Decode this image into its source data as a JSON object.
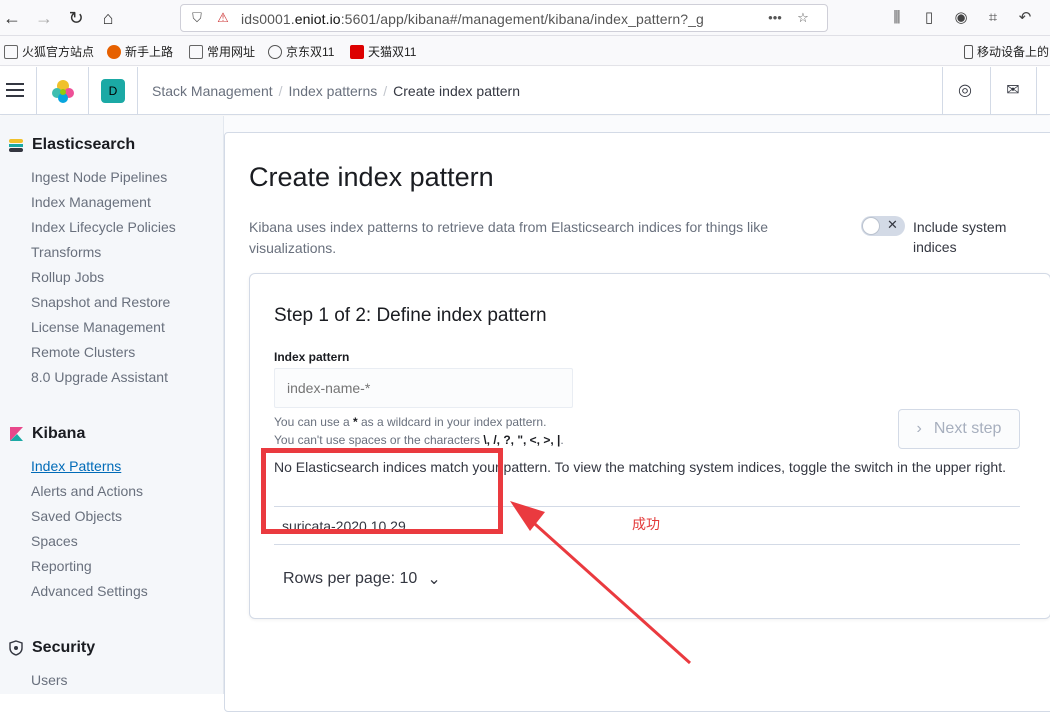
{
  "browser": {
    "url_prefix": "ids0001.",
    "url_host": "eniot.io",
    "url_rest": ":5601/app/kibana#/management/kibana/index_pattern?_g",
    "bookmarks": [
      "火狐官方站点",
      "新手上路",
      "常用网址",
      "京东双11",
      "天猫双11",
      "移动设备上的"
    ]
  },
  "header": {
    "space_initial": "D",
    "breadcrumbs": [
      "Stack Management",
      "Index patterns",
      "Create index pattern"
    ]
  },
  "sidebar": {
    "elasticsearch": {
      "title": "Elasticsearch",
      "items": [
        "Ingest Node Pipelines",
        "Index Management",
        "Index Lifecycle Policies",
        "Transforms",
        "Rollup Jobs",
        "Snapshot and Restore",
        "License Management",
        "Remote Clusters",
        "8.0 Upgrade Assistant"
      ]
    },
    "kibana": {
      "title": "Kibana",
      "items": [
        "Index Patterns",
        "Alerts and Actions",
        "Saved Objects",
        "Spaces",
        "Reporting",
        "Advanced Settings"
      ]
    },
    "security": {
      "title": "Security",
      "items": [
        "Users"
      ]
    }
  },
  "main": {
    "title": "Create index pattern",
    "description": "Kibana uses index patterns to retrieve data from Elasticsearch indices for things like visualizations.",
    "toggle_label": "Include system indices",
    "step_title": "Step 1 of 2: Define index pattern",
    "field_label": "Index pattern",
    "field_placeholder": "index-name-*",
    "help_1_pre": "You can use a ",
    "help_1_star": "*",
    "help_1_post": " as a wildcard in your index pattern.",
    "help_2_pre": "You can't use spaces or the characters ",
    "help_2_chars": "\\, /, ?, \", <, >, |",
    "help_2_post": ".",
    "next_button": "Next step",
    "warning": "No Elasticsearch indices match your pattern. To view the matching system indices, toggle the switch in the upper right.",
    "index_row": "suricata-2020.10.29",
    "rows_per_page": "Rows per page: 10"
  },
  "annotation": {
    "text": "成功",
    "color": "#ea3a3f"
  }
}
